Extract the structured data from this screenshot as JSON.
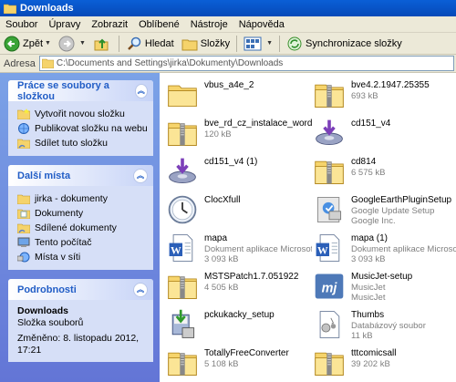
{
  "window": {
    "title": "Downloads"
  },
  "menu": [
    "Soubor",
    "Úpravy",
    "Zobrazit",
    "Oblíbené",
    "Nástroje",
    "Nápověda"
  ],
  "toolbar": {
    "back_label": "Zpět",
    "search_label": "Hledat",
    "folders_label": "Složky",
    "sync_label": "Synchronizace složky"
  },
  "address": {
    "label": "Adresa",
    "value": "C:\\Documents and Settings\\jirka\\Dokumenty\\Downloads"
  },
  "tasks": {
    "title": "Práce se soubory a složkou",
    "items": [
      {
        "label": "Vytvořit novou složku",
        "icon": "new-folder-icon"
      },
      {
        "label": "Publikovat složku na webu",
        "icon": "publish-web-icon"
      },
      {
        "label": "Sdílet tuto složku",
        "icon": "share-folder-icon"
      }
    ]
  },
  "places": {
    "title": "Další místa",
    "items": [
      {
        "label": "jirka - dokumenty",
        "icon": "folder-icon"
      },
      {
        "label": "Dokumenty",
        "icon": "documents-icon"
      },
      {
        "label": "Sdílené dokumenty",
        "icon": "shared-folder-icon"
      },
      {
        "label": "Tento počítač",
        "icon": "computer-icon"
      },
      {
        "label": "Místa v síti",
        "icon": "network-icon"
      }
    ]
  },
  "details": {
    "title": "Podrobnosti",
    "name": "Downloads",
    "type": "Složka souborů",
    "modified": "Změněno: 8. listopadu 2012, 17:21"
  },
  "files": [
    {
      "name": "vbus_a4e_2",
      "line1": "",
      "line2": "",
      "icon": "folder"
    },
    {
      "name": "bve4.2.1947.25355",
      "line1": "693 kB",
      "line2": "",
      "icon": "zip"
    },
    {
      "name": "bve_rd_cz_instalace_word",
      "line1": "120 kB",
      "line2": "",
      "icon": "zip"
    },
    {
      "name": "cd151_v4",
      "line1": "",
      "line2": "",
      "icon": "disk"
    },
    {
      "name": "cd151_v4 (1)",
      "line1": "",
      "line2": "",
      "icon": "disk"
    },
    {
      "name": "cd814",
      "line1": "6 575 kB",
      "line2": "",
      "icon": "zip"
    },
    {
      "name": "ClocXfull",
      "line1": "",
      "line2": "",
      "icon": "clock"
    },
    {
      "name": "GoogleEarthPluginSetup",
      "line1": "Google Update Setup",
      "line2": "Google Inc.",
      "icon": "setup"
    },
    {
      "name": "mapa",
      "line1": "Dokument aplikace Microsoft ...",
      "line2": "3 093 kB",
      "icon": "word"
    },
    {
      "name": "mapa (1)",
      "line1": "Dokument aplikace Microsoft ...",
      "line2": "3 093 kB",
      "icon": "word"
    },
    {
      "name": "MSTSPatch1.7.051922",
      "line1": "4 505 kB",
      "line2": "",
      "icon": "zip"
    },
    {
      "name": "MusicJet-setup",
      "line1": "MusicJet",
      "line2": "MusicJet",
      "icon": "musicjet"
    },
    {
      "name": "pckukacky_setup",
      "line1": "",
      "line2": "",
      "icon": "installer"
    },
    {
      "name": "Thumbs",
      "line1": "Databázový soubor",
      "line2": "11 kB",
      "icon": "db"
    },
    {
      "name": "TotallyFreeConverter",
      "line1": "5 108 kB",
      "line2": "",
      "icon": "zip"
    },
    {
      "name": "tttcomicsall",
      "line1": "39 202 kB",
      "line2": "",
      "icon": "zip"
    }
  ]
}
